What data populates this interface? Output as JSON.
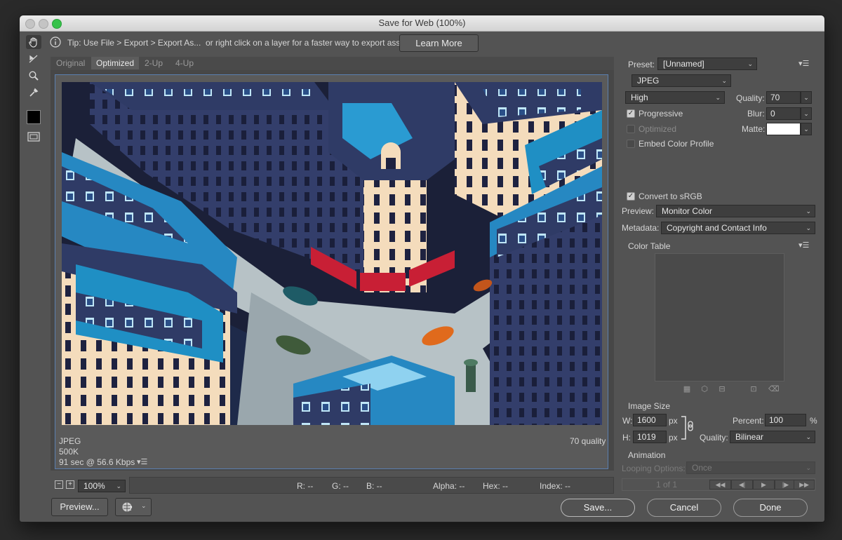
{
  "window": {
    "title": "Save for Web (100%)"
  },
  "tip": {
    "text": "Tip: Use File > Export > Export As...  or right click on a layer for a faster way to export assets",
    "learn_more": "Learn More"
  },
  "tabs": [
    {
      "label": "Original",
      "active": false
    },
    {
      "label": "Optimized",
      "active": true
    },
    {
      "label": "2-Up",
      "active": false
    },
    {
      "label": "4-Up",
      "active": false
    }
  ],
  "image_info": {
    "format": "JPEG",
    "size": "500K",
    "time": "91 sec @ 56.6 Kbps",
    "quality_text": "70 quality"
  },
  "status": {
    "zoom": "100%",
    "r": "R: --",
    "g": "G: --",
    "b": "B: --",
    "alpha": "Alpha: --",
    "hex": "Hex: --",
    "index": "Index: --"
  },
  "footer": {
    "preview": "Preview...",
    "save": "Save...",
    "cancel": "Cancel",
    "done": "Done"
  },
  "settings": {
    "preset_label": "Preset:",
    "preset_value": "[Unnamed]",
    "format": "JPEG",
    "quality_level": "High",
    "quality_label": "Quality:",
    "quality_value": "70",
    "progressive": "Progressive",
    "progressive_checked": true,
    "blur_label": "Blur:",
    "blur_value": "0",
    "optimized": "Optimized",
    "optimized_checked": false,
    "matte_label": "Matte:",
    "matte_color": "#ffffff",
    "embed": "Embed Color Profile",
    "embed_checked": false,
    "srgb": "Convert to sRGB",
    "srgb_checked": true,
    "preview_label": "Preview:",
    "preview_value": "Monitor Color",
    "metadata_label": "Metadata:",
    "metadata_value": "Copyright and Contact Info",
    "color_table": "Color Table"
  },
  "image_size": {
    "title": "Image Size",
    "w_label": "W:",
    "w_value": "1600",
    "h_label": "H:",
    "h_value": "1019",
    "unit": "px",
    "percent_label": "Percent:",
    "percent_value": "100",
    "percent_sign": "%",
    "quality_label": "Quality:",
    "quality_value": "Bilinear"
  },
  "animation": {
    "title": "Animation",
    "looping_label": "Looping Options:",
    "looping_value": "Once",
    "frame": "1 of 1"
  },
  "colors": {
    "accent_selection": "#5b7fb0",
    "sky_blue": "#1f8fc4",
    "roof_navy": "#2f3b66",
    "facade_cream": "#f6ddbd",
    "awning_red": "#c81f35"
  },
  "icons": {
    "hand": "hand-tool-icon",
    "slice": "slice-select-tool-icon",
    "zoom": "zoom-tool-icon",
    "eyedropper": "eyedropper-tool-icon",
    "info": "info-icon"
  }
}
